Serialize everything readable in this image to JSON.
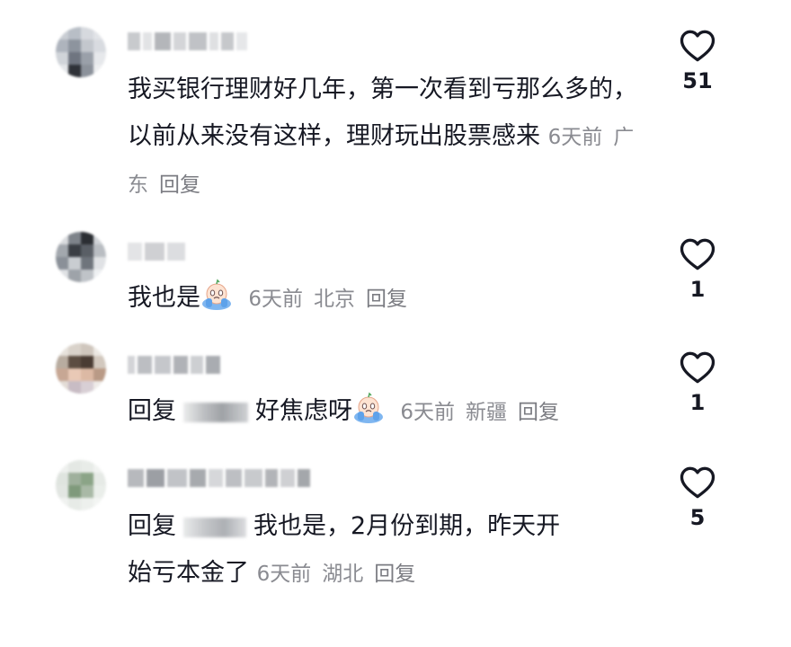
{
  "comments": [
    {
      "text": "我买银行理财好几年，第一次看到亏那么多的，以前从来没有这样，理财玩出股票感来",
      "time": "6天前",
      "location": "广东",
      "reply_label": "回复",
      "likes": "51",
      "icon": "heart-outline-icon"
    },
    {
      "text": "我也是",
      "emoji": "crying-emoji-icon",
      "time": "6天前",
      "location": "北京",
      "reply_label": "回复",
      "likes": "1",
      "icon": "heart-outline-icon"
    },
    {
      "prefix": "回复",
      "text": "好焦虑呀",
      "emoji": "crying-emoji-icon",
      "time": "6天前",
      "location": "新疆",
      "reply_label": "回复",
      "likes": "1",
      "icon": "heart-outline-icon"
    },
    {
      "prefix": "回复",
      "text_line1": "我也是，2月份到期，昨天开",
      "text_line2": "始亏本金了",
      "time": "6天前",
      "location": "湖北",
      "reply_label": "回复",
      "likes": "5",
      "icon": "heart-outline-icon"
    }
  ],
  "colors": {
    "text": "#161823",
    "meta": "#8a8b91",
    "background": "#ffffff"
  }
}
